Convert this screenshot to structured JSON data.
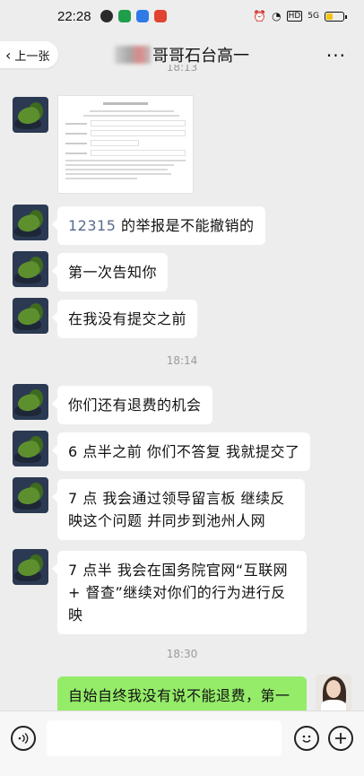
{
  "status_bar": {
    "time": "22:28",
    "signal_label": "5G"
  },
  "header": {
    "back_label": "上一张",
    "title": "哥哥石台高一",
    "more": "···"
  },
  "messages": [
    {
      "type": "doc-image",
      "from": "other"
    },
    {
      "type": "text",
      "from": "other",
      "number": "12315",
      "text": " 的举报是不能撤销的"
    },
    {
      "type": "text",
      "from": "other",
      "text": "第一次告知你"
    },
    {
      "type": "text",
      "from": "other",
      "text": "在我没有提交之前"
    },
    {
      "type": "time",
      "text": "18:14"
    },
    {
      "type": "text",
      "from": "other",
      "text": "你们还有退费的机会"
    },
    {
      "type": "text",
      "from": "other",
      "text": "6 点半之前 你们不答复 我就提交了"
    },
    {
      "type": "text",
      "from": "other",
      "text": "7 点 我会通过领导留言板 继续反映这个问题 并同步到池州人网"
    },
    {
      "type": "text",
      "from": "other",
      "text": "7 点半 我会在国务院官网“互联网 + 督查”继续对你们的行为进行反映"
    },
    {
      "type": "time",
      "text": "18:30"
    },
    {
      "type": "text",
      "from": "self",
      "text": "自始自终我没有说不能退费，第一"
    }
  ],
  "timestamps": {
    "top_partial": "18:13",
    "t1": "18:14",
    "t2": "18:30"
  },
  "input_bar": {
    "voice_icon": "voice-icon",
    "emoji_icon": "emoji-icon",
    "plus_icon": "plus-icon"
  },
  "colors": {
    "background": "#ededed",
    "bubble_other": "#ffffff",
    "bubble_self": "#95ec69",
    "number_link": "#5b6b8c"
  }
}
